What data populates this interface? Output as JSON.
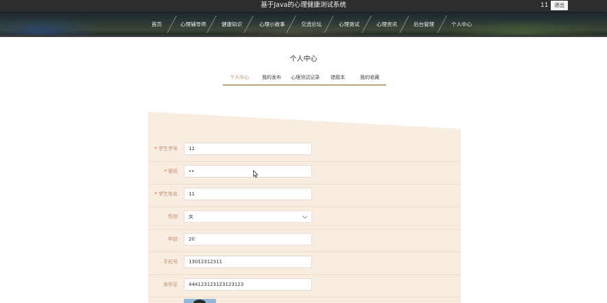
{
  "header": {
    "site_title": "基于Java的心理健康测试系统",
    "user_name": "11",
    "logout_label": "退出"
  },
  "nav": {
    "items": [
      "首页",
      "心理辅导师",
      "健康知识",
      "心理小故事",
      "交流论坛",
      "心理测试",
      "心理资讯",
      "后台管理",
      "个人中心"
    ]
  },
  "page": {
    "heading": "个人中心"
  },
  "tabs": {
    "items": [
      "个人中心",
      "我的发布",
      "心理测试记录",
      "错题本",
      "我的收藏"
    ],
    "active": "个人中心"
  },
  "form": {
    "student_id": {
      "label": "学生学号",
      "required": true,
      "value": "11"
    },
    "password": {
      "label": "密码",
      "required": true,
      "value": "••"
    },
    "student_name": {
      "label": "学生姓名",
      "required": true,
      "value": "11"
    },
    "gender": {
      "label": "性别",
      "required": false,
      "value": "女"
    },
    "age": {
      "label": "年龄",
      "required": false,
      "value": "20"
    },
    "phone": {
      "label": "手机号",
      "required": false,
      "value": "13012312311"
    },
    "id_card": {
      "label": "身份证",
      "required": false,
      "value": "444123123123123123"
    }
  },
  "colors": {
    "accent": "#c4a37c",
    "panel_bg": "#f9ece0",
    "label": "#c09070",
    "required_mark": "#d9534f"
  }
}
